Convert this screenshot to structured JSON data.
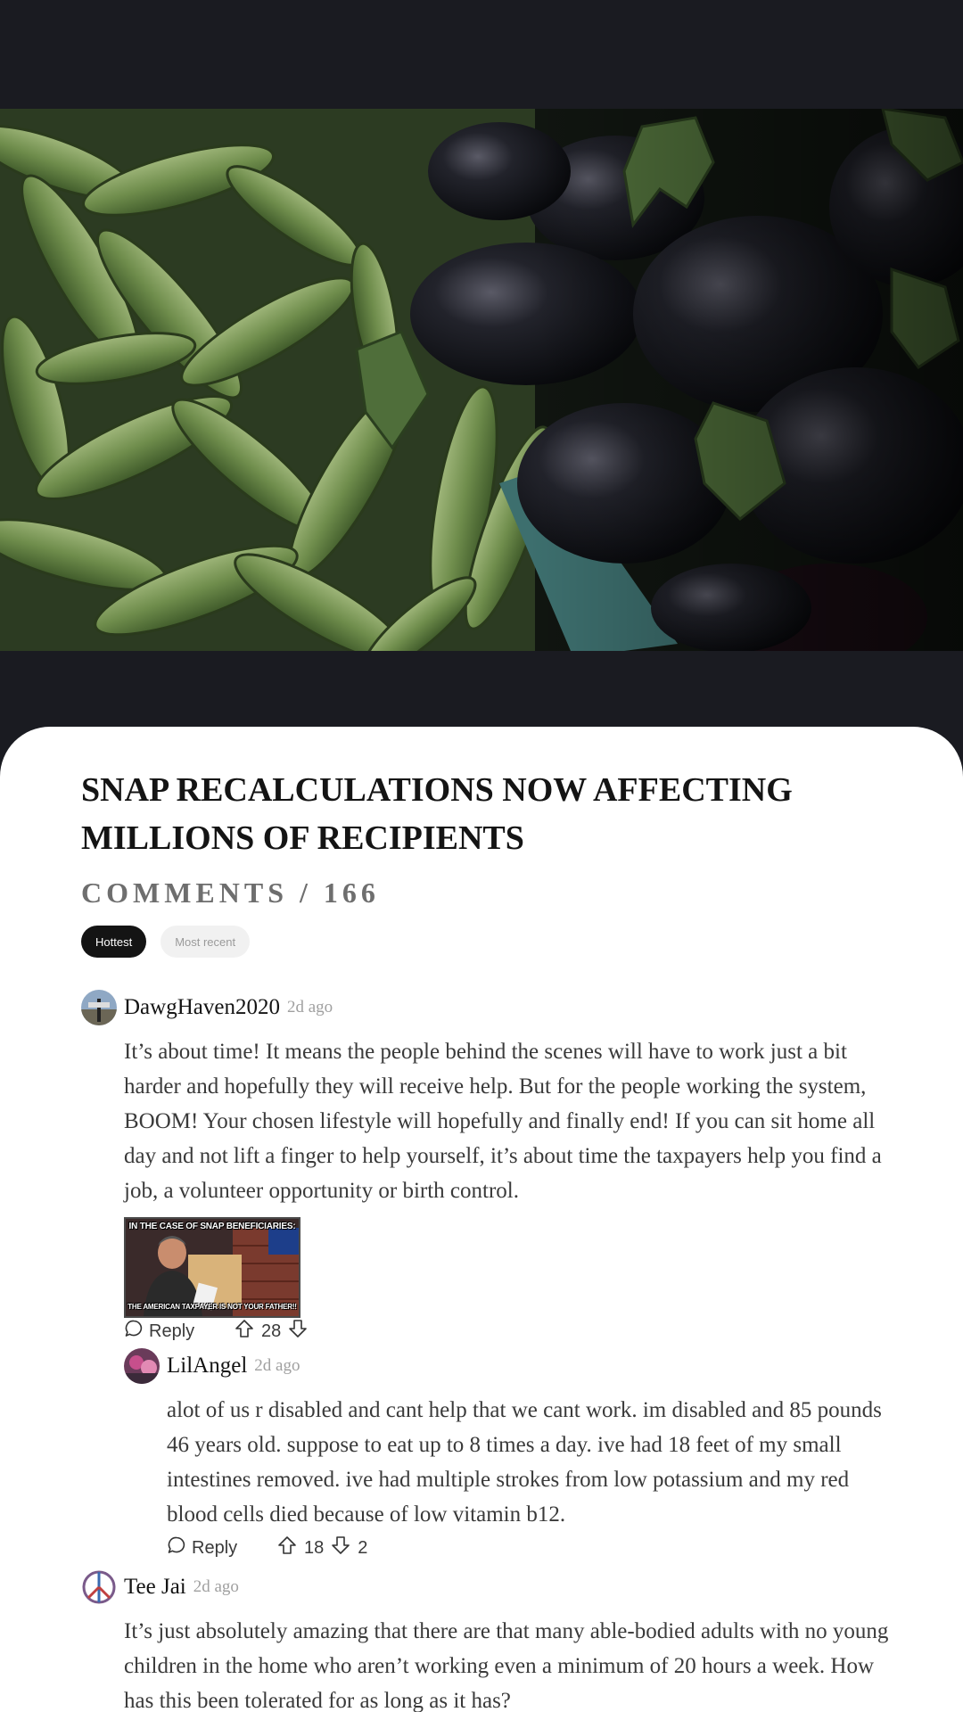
{
  "article": {
    "title": "SNAP RECALCULATIONS NOW AFFECTING MILLIONS OF RECIPIENTS"
  },
  "comments_section": {
    "heading": "COMMENTS / 166",
    "tabs": [
      {
        "label": "Hottest",
        "active": true
      },
      {
        "label": "Most recent",
        "active": false
      }
    ]
  },
  "comments": [
    {
      "username": "DawgHaven2020",
      "time": "2d ago",
      "body": "It’s about time! It means the people behind the scenes will have to work just a bit harder and hopefully they will receive help. But for the people working the system, BOOM! Your chosen lifestyle will hopefully and finally end! If you can sit home all day and not lift a finger to help yourself, it’s about time the taxpayers help you find a job, a volunteer opportunity or birth control.",
      "meme": {
        "top_text": "IN THE CASE OF SNAP BENEFICIARIES:",
        "bottom_text": "THE AMERICAN TAXPAYER IS NOT YOUR FATHER!!"
      },
      "reply_label": "Reply",
      "upvotes": "28",
      "downvotes": ""
    },
    {
      "username": "LilAngel",
      "time": "2d ago",
      "body": "alot of us r disabled and cant help that we cant work. im disabled and 85 pounds 46 years old. suppose to eat up to 8 times a day. ive had 18 feet of my small intestines removed. ive had multiple strokes from low potassium and my red blood cells died because of low vitamin b12.",
      "reply_label": "Reply",
      "upvotes": "18",
      "downvotes": "2"
    },
    {
      "username": "Tee Jai",
      "time": "2d ago",
      "body": "It’s just absolutely amazing that there are that many able-bodied adults with no young children in the home who aren’t working even a minimum of 20 hours a week. How has this been tolerated for as long as it has?"
    }
  ],
  "icons": {
    "reply": "speech-bubble-icon",
    "upvote": "arrow-up-outline-icon",
    "downvote": "arrow-down-outline-icon"
  },
  "colors": {
    "page_background": "#1a1b21",
    "card_background": "#ffffff",
    "active_tab": "#141414",
    "inactive_tab": "#f1f1f1"
  }
}
